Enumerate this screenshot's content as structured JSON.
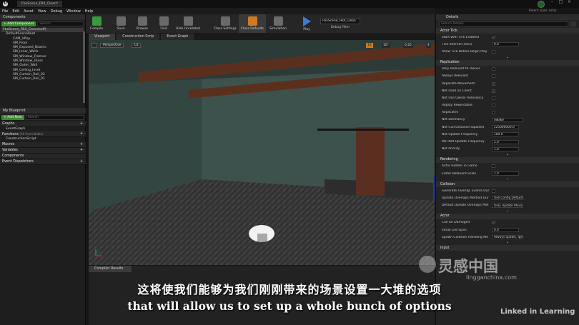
{
  "window_tab": "FbxScene_FBX_Clean*",
  "top_right_hint": "Parent class: Actor",
  "menu": [
    "File",
    "Edit",
    "Asset",
    "View",
    "Debug",
    "Window",
    "Help"
  ],
  "toolbar": [
    {
      "label": "Compile",
      "icon": "compile-check-icon",
      "color": "#3a9a3a"
    },
    {
      "label": "Save",
      "icon": "save-icon",
      "color": "#6c6c6c"
    },
    {
      "label": "Browse",
      "icon": "browse-icon",
      "color": "#6c6c6c"
    },
    {
      "label": "Find",
      "icon": "find-icon",
      "color": "#6c6c6c"
    },
    {
      "label": "Hide Unrelated",
      "icon": "hide-unrelated-icon",
      "color": "#6c6c6c"
    },
    {
      "label": "Class Settings",
      "icon": "class-settings-icon",
      "color": "#6c6c6c"
    },
    {
      "label": "Class Defaults",
      "icon": "class-defaults-icon",
      "color": "#d07a20"
    },
    {
      "label": "Simulation",
      "icon": "simulation-icon",
      "color": "#6c6c6c"
    },
    {
      "label": "Play",
      "icon": "play-icon",
      "color": "#3a7ad0"
    }
  ],
  "debug": {
    "value": "FbxScene_FBX_Clean",
    "label": "Debug Filter"
  },
  "components": {
    "title": "Components",
    "add_label": "+ Add Component",
    "search_placeholder": "Search",
    "self": "FbxScene_FBX_Clean(self)",
    "items": [
      "DefaultSceneRoot",
      "CAM_VRay",
      "SM_Floor",
      "SM_Exposed_Beams",
      "SM_Inner_Walls",
      "SM_Window_Frames",
      "SM_Window_Glass",
      "SM_Outer_Wall",
      "SM_Ceiling_Inset",
      "SM_Curtain_Rail_02",
      "SM_Curtain_Rail_01"
    ]
  },
  "my_blueprint": {
    "title": "My Blueprint",
    "add_new": "+ Add New",
    "search_placeholder": "Search",
    "sections": [
      {
        "label": "Graphs",
        "children": [
          "EventGraph"
        ]
      },
      {
        "label": "Functions",
        "note": "(18 Overridable)",
        "children": [
          "ConstructionScript"
        ]
      },
      {
        "label": "Macros",
        "children": []
      },
      {
        "label": "Variables",
        "children": []
      },
      {
        "label": "Components",
        "children": []
      },
      {
        "label": "Event Dispatchers",
        "children": []
      }
    ]
  },
  "center_tabs": [
    "Viewport",
    "Construction Scrip",
    "Event Graph"
  ],
  "viewport_toolbar": {
    "perspective": "Perspective",
    "lit": "Lit",
    "grid": "10",
    "angle": "10°",
    "scale": "0.25",
    "cam": "4"
  },
  "compiler_results": "Compiler Results",
  "details": {
    "title": "Details",
    "search_placeholder": "Search Details",
    "sections": [
      {
        "name": "Actor Tick",
        "rows": [
          {
            "label": "Start with Tick Enabled",
            "type": "check",
            "checked": true
          },
          {
            "label": "Tick Interval (secs)",
            "type": "field",
            "value": "0.0"
          },
          {
            "label": "Allow Tick Before Begin Play",
            "type": "check",
            "checked": false
          }
        ]
      },
      {
        "name": "Replication",
        "rows": [
          {
            "label": "Only Relevant to Owner",
            "type": "check",
            "checked": false
          },
          {
            "label": "Always Relevant",
            "type": "check",
            "checked": false
          },
          {
            "label": "Replicate Movement",
            "type": "check",
            "checked": true
          },
          {
            "label": "Net Load on Client",
            "type": "check",
            "checked": true
          },
          {
            "label": "Net Use Owner Relevancy",
            "type": "check",
            "checked": false
          },
          {
            "label": "Replay Rewindable",
            "type": "check",
            "checked": false
          },
          {
            "label": "Replicates",
            "type": "check",
            "checked": false
          },
          {
            "label": "Net Dormancy",
            "type": "select",
            "value": "Awake"
          },
          {
            "label": "Net Cull Distance Squared",
            "type": "field",
            "value": "225000000.0"
          },
          {
            "label": "Net Update Frequency",
            "type": "field",
            "value": "100.0"
          },
          {
            "label": "Min Net Update Frequency",
            "type": "field",
            "value": "2.0"
          },
          {
            "label": "Net Priority",
            "type": "field",
            "value": "1.0"
          }
        ]
      },
      {
        "name": "Rendering",
        "rows": [
          {
            "label": "Actor Hidden in Game",
            "type": "check",
            "checked": false
          },
          {
            "label": "Editor Billboard Scale",
            "type": "field",
            "value": "1.0"
          }
        ]
      },
      {
        "name": "Collision",
        "rows": [
          {
            "label": "Generate Overlap Events Dur",
            "type": "check",
            "checked": false
          },
          {
            "label": "Update Overlaps Method Dur",
            "type": "select",
            "value": "Use Config Default"
          },
          {
            "label": "Default Update Overlaps Met",
            "type": "select",
            "value": "Only Update Movable"
          }
        ]
      },
      {
        "name": "Actor",
        "rows": [
          {
            "label": "Can be Damaged",
            "type": "check",
            "checked": true
          },
          {
            "label": "Initial Life Span",
            "type": "field",
            "value": "0.0"
          },
          {
            "label": "Spawn Collision Handling Me",
            "type": "select",
            "value": "Always Spawn, Ignore Collisions"
          }
        ]
      },
      {
        "name": "Input",
        "rows": []
      }
    ]
  },
  "subtitles": {
    "zh": "这将使我们能够为我们刚刚带来的场景设置一大堆的选项",
    "en": "that will allow us to set up a whole bunch of options"
  },
  "watermark": {
    "brand": "灵感中国",
    "url": "lingganchina.com",
    "linkedin": "Linked in Learning"
  }
}
